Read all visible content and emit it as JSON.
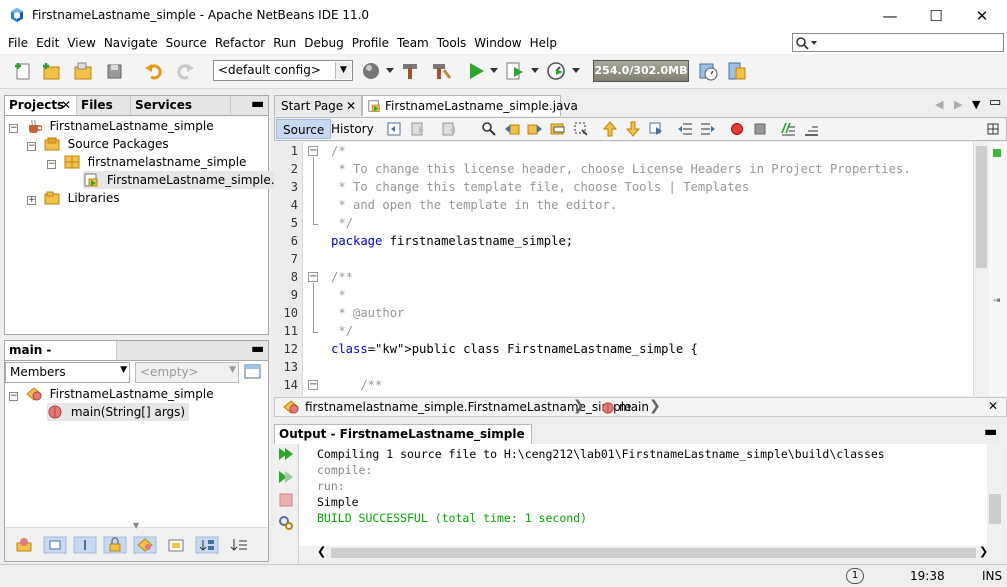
{
  "window": {
    "title": "FirstnameLastname_simple - Apache NetBeans IDE 11.0",
    "minimize": "—",
    "maximize": "☐",
    "close": "✕"
  },
  "menu": [
    "File",
    "Edit",
    "View",
    "Navigate",
    "Source",
    "Refactor",
    "Run",
    "Debug",
    "Profile",
    "Team",
    "Tools",
    "Window",
    "Help"
  ],
  "search": {
    "placeholder": "",
    "icon": "magnifier-icon"
  },
  "toolbar": {
    "config": "<default config>",
    "memory": "254.0/302.0MB"
  },
  "projects_panel": {
    "tabs": [
      "Projects",
      "Files",
      "Services"
    ],
    "tree": [
      {
        "label": "FirstnameLastname_simple",
        "level": 0,
        "icon": "project-icon",
        "expander": "−"
      },
      {
        "label": "Source Packages",
        "level": 1,
        "icon": "source-packages-icon",
        "expander": "−"
      },
      {
        "label": "firstnamelastname_simple",
        "level": 2,
        "icon": "package-icon",
        "expander": "−"
      },
      {
        "label": "FirstnameLastname_simple.java",
        "level": 3,
        "icon": "java-file-icon",
        "expander": ""
      },
      {
        "label": "Libraries",
        "level": 1,
        "icon": "libraries-icon",
        "expander": "+"
      }
    ]
  },
  "navigator": {
    "title": "main - Navigator",
    "filter": "Members",
    "empty": "<empty>",
    "tree": [
      {
        "label": "FirstnameLastname_simple",
        "level": 0
      },
      {
        "label": "main(String[] args)",
        "level": 1
      }
    ]
  },
  "editor": {
    "tabs": [
      "Start Page",
      "FirstnameLastname_simple.java"
    ],
    "source_label": "Source",
    "history_label": "History",
    "line_numbers": [
      "1",
      "2",
      "3",
      "4",
      "5",
      "6",
      "7",
      "8",
      "9",
      "10",
      "11",
      "12",
      "13",
      "14"
    ],
    "lines": [
      "/*",
      " * To change this license header, choose License Headers in Project Properties.",
      " * To change this template file, choose Tools | Templates",
      " * and open the template in the editor.",
      " */",
      "package firstnamelastname_simple;",
      "",
      "/**",
      " *",
      " * @author",
      " */",
      "public class FirstnameLastname_simple {",
      "",
      "    /**"
    ],
    "breadcrumb_class": "firstnamelastname_simple.FirstnameLastname_simple",
    "breadcrumb_method": "main"
  },
  "output": {
    "title": "Output - FirstnameLastname_simple (run)",
    "lines": [
      "Compiling 1 source file to H:\\ceng212\\lab01\\FirstnameLastname_simple\\build\\classes",
      "compile:",
      "run:",
      "Simple",
      "BUILD SUCCESSFUL (total time: 1 second)"
    ]
  },
  "status": {
    "notifications": "1",
    "position": "19:38",
    "mode": "INS"
  },
  "colors": {
    "keyword": "#0000e6",
    "comment": "#969696",
    "success": "#00aa00",
    "selection": "#c6d9f0"
  }
}
